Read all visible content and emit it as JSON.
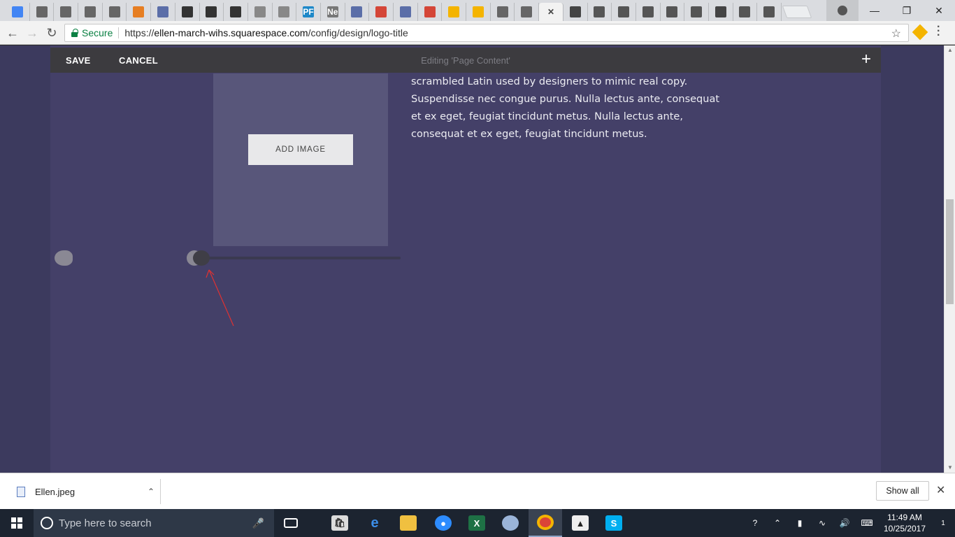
{
  "browser": {
    "tabs": [
      {
        "icon": "chrome-icon",
        "color": "#4285f4"
      },
      {
        "icon": "cube-icon",
        "color": "#666"
      },
      {
        "icon": "cube-icon",
        "color": "#666"
      },
      {
        "icon": "cube-icon",
        "color": "#666"
      },
      {
        "icon": "cube-icon",
        "color": "#666"
      },
      {
        "icon": "puzzle-icon",
        "color": "#e67e22"
      },
      {
        "icon": "doc-icon",
        "color": "#5b6ea8"
      },
      {
        "icon": "wikipedia-icon",
        "color": "#333"
      },
      {
        "icon": "wikipedia-icon",
        "color": "#333"
      },
      {
        "icon": "wikipedia-icon",
        "color": "#333"
      },
      {
        "icon": "page-icon",
        "color": "#888"
      },
      {
        "icon": "page-icon",
        "color": "#888"
      },
      {
        "icon": "pf-icon",
        "color": "#1e88c8",
        "label": "PF"
      },
      {
        "icon": "news-icon",
        "color": "#777",
        "label": "Ne"
      },
      {
        "icon": "doc-icon",
        "color": "#5b6ea8"
      },
      {
        "icon": "gmail-icon",
        "color": "#d44638"
      },
      {
        "icon": "doc-icon",
        "color": "#5b6ea8"
      },
      {
        "icon": "gmail-icon",
        "color": "#d44638"
      },
      {
        "icon": "drive-icon",
        "color": "#f4b400"
      },
      {
        "icon": "drive-icon",
        "color": "#f4b400"
      },
      {
        "icon": "cube-icon",
        "color": "#666"
      },
      {
        "icon": "cube-icon",
        "color": "#666"
      },
      {
        "icon": "active-tab-close-icon",
        "color": "#f2f2f2",
        "label": "✕"
      },
      {
        "icon": "squarespace-icon",
        "color": "#444"
      },
      {
        "icon": "cloud-icon",
        "color": "#555"
      },
      {
        "icon": "cloud-icon",
        "color": "#555"
      },
      {
        "icon": "cloud-icon",
        "color": "#555"
      },
      {
        "icon": "cloud-icon",
        "color": "#555"
      },
      {
        "icon": "cloud-icon",
        "color": "#555"
      },
      {
        "icon": "squarespace-icon",
        "color": "#444"
      },
      {
        "icon": "cloud-icon",
        "color": "#555"
      },
      {
        "icon": "cloud-icon",
        "color": "#555"
      }
    ],
    "secure_label": "Secure",
    "url_scheme": "https://",
    "url_host": "ellen-march-wihs.squarespace.com",
    "url_path": "/config/design/logo-title"
  },
  "editor": {
    "save_label": "SAVE",
    "cancel_label": "CANCEL",
    "title": "Editing 'Page Content'",
    "add_image_label": "ADD IMAGE",
    "body_text": "scrambled Latin used by designers to mimic real copy. Suspendisse nec congue purus. Nulla lectus ante, consequat et ex eget, feugiat tincidunt metus. Nulla lectus ante, consequat et ex eget, feugiat tincidunt metus.",
    "background_color": "#444068",
    "slider_value": 0
  },
  "downloads": {
    "file_name": "Ellen.jpeg",
    "show_all_label": "Show all"
  },
  "taskbar": {
    "search_placeholder": "Type here to search",
    "time": "11:49 AM",
    "date": "10/25/2017",
    "notification_count": "1"
  }
}
